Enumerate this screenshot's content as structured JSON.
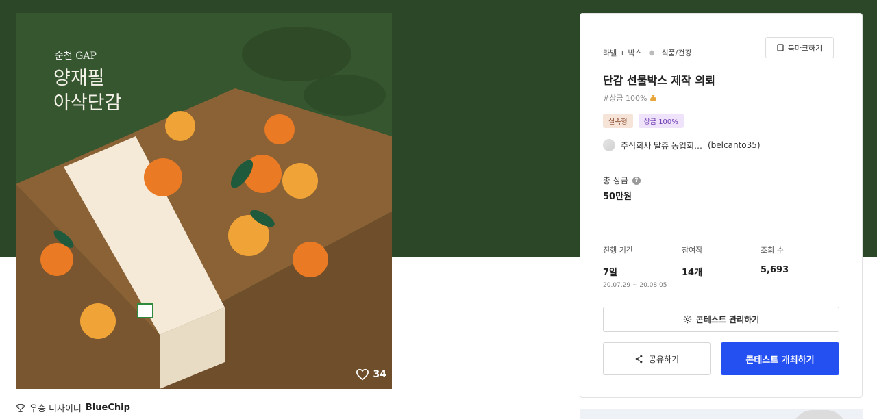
{
  "image": {
    "caption_small": "순천 GAP",
    "caption_big": "양재필\n아삭단감",
    "box_label_small": "순천 GAP",
    "box_label_big": "양재필\n아삭단감",
    "likes": "34"
  },
  "winner": {
    "label": "우승 디자이너",
    "name": "BlueChip"
  },
  "panel": {
    "category_primary": "라벨 + 박스",
    "category_secondary": "식품/건강",
    "bookmark_label": "북마크하기",
    "title": "단감 선물박스 제작 의뢰",
    "hashtag": "#상금 100%",
    "badges": [
      "실속형",
      "상금 100%"
    ],
    "company": "주식회사 달쥬 농업회…",
    "handle": "(belcanto35)",
    "prize_label": "총 상금",
    "prize_value": "50만원",
    "stats": [
      {
        "label": "진행 기간",
        "value": "7일",
        "sub": "20.07.29 ~ 20.08.05"
      },
      {
        "label": "참여작",
        "value": "14개"
      },
      {
        "label": "조회 수",
        "value": "5,693"
      }
    ],
    "manage_label": "콘테스트 관리하기",
    "share_label": "공유하기",
    "host_label": "콘테스트 개최하기"
  },
  "colors": {
    "hero_bg": "#2b4727",
    "primary_button": "#2450f2"
  }
}
